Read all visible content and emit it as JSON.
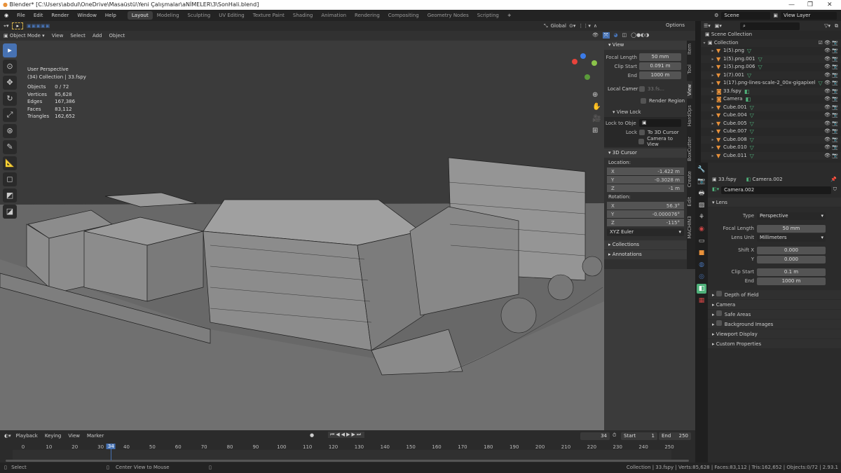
{
  "window": {
    "title": "Blender* [C:\\Users\\abdul\\OneDrive\\Masaüstü\\Yeni Çalışmalar\\aNİMELER\\3\\SonHali.blend]"
  },
  "menu": [
    "File",
    "Edit",
    "Render",
    "Window",
    "Help"
  ],
  "workspaces": [
    "Layout",
    "Modeling",
    "Sculpting",
    "UV Editing",
    "Texture Paint",
    "Shading",
    "Animation",
    "Rendering",
    "Compositing",
    "Geometry Nodes",
    "Scripting"
  ],
  "active_workspace": "Layout",
  "scene": "Scene",
  "view_layer": "View Layer",
  "viewport": {
    "orientation": "Global",
    "options": "Options",
    "mode": "Object Mode",
    "menus": [
      "View",
      "Select",
      "Add",
      "Object"
    ],
    "overlay_title": "User Perspective",
    "overlay_subtitle": "(34) Collection | 33.fspy",
    "stats": [
      [
        "Objects",
        "0 / 72"
      ],
      [
        "Vertices",
        "85,628"
      ],
      [
        "Edges",
        "167,386"
      ],
      [
        "Faces",
        "83,112"
      ],
      [
        "Triangles",
        "162,652"
      ]
    ]
  },
  "npanel": {
    "tabs": [
      "Item",
      "Tool",
      "View",
      "HardOps",
      "BoxCutter",
      "Create",
      "Edit",
      "MACHIN3"
    ],
    "active_tab": "View",
    "view": {
      "title": "View",
      "focal_length_label": "Focal Length",
      "focal_length": "50 mm",
      "clip_start_label": "Clip Start",
      "clip_start": "0.091 m",
      "end_label": "End",
      "end": "1000 m",
      "local_camera_label": "Local Camer",
      "local_camera": "33.fs...",
      "render_region": "Render Region"
    },
    "view_lock": {
      "title": "View Lock",
      "lock_to_object": "Lock to Obje",
      "lock": "Lock",
      "to_3d_cursor": "To 3D Cursor",
      "camera_to_view": "Camera to View"
    },
    "cursor": {
      "title": "3D Cursor",
      "location": "Location:",
      "loc": [
        [
          "X",
          "-1.422 m"
        ],
        [
          "Y",
          "-0.3028 m"
        ],
        [
          "Z",
          "-1 m"
        ]
      ],
      "rotation": "Rotation:",
      "rot": [
        [
          "X",
          "56.3°"
        ],
        [
          "Y",
          "-0.000076°"
        ],
        [
          "Z",
          "-115°"
        ]
      ],
      "mode": "XYZ Euler"
    },
    "collections": "Collections",
    "annotations": "Annotations"
  },
  "outliner": {
    "scene_collection": "Scene Collection",
    "collection": "Collection",
    "items": [
      {
        "name": "1(5).png",
        "type": "mesh"
      },
      {
        "name": "1(5).png.001",
        "type": "mesh"
      },
      {
        "name": "1(5).png.006",
        "type": "mesh"
      },
      {
        "name": "1(7).001",
        "type": "mesh"
      },
      {
        "name": "1(17).png-lines-scale-2_00x-gigapixel",
        "type": "mesh"
      },
      {
        "name": "33.fspy",
        "type": "camera"
      },
      {
        "name": "Camera",
        "type": "camera"
      },
      {
        "name": "Cube.001",
        "type": "mesh"
      },
      {
        "name": "Cube.004",
        "type": "mesh"
      },
      {
        "name": "Cube.005",
        "type": "mesh"
      },
      {
        "name": "Cube.007",
        "type": "mesh"
      },
      {
        "name": "Cube.008",
        "type": "mesh"
      },
      {
        "name": "Cube.010",
        "type": "mesh"
      },
      {
        "name": "Cube.011",
        "type": "mesh"
      }
    ]
  },
  "properties": {
    "object": "33.fspy",
    "data": "Camera.002",
    "datablock": "Camera.002",
    "lens": "Lens",
    "type_label": "Type",
    "type": "Perspective",
    "focal_label": "Focal Length",
    "focal": "50 mm",
    "unit_label": "Lens Unit",
    "unit": "Millimeters",
    "shiftx_label": "Shift X",
    "shiftx": "0.000",
    "shifty_label": "Y",
    "shifty": "0.000",
    "clip_start_label": "Clip Start",
    "clip_start": "0.1 m",
    "clip_end_label": "End",
    "clip_end": "1000 m",
    "subpanels": [
      "Depth of Field",
      "Camera",
      "Safe Areas",
      "Background Images",
      "Viewport Display",
      "Custom Properties"
    ]
  },
  "timeline": {
    "menus": [
      "Playback",
      "Keying",
      "View",
      "Marker"
    ],
    "current_frame": "34",
    "start_label": "Start",
    "start": "1",
    "end_label": "End",
    "end": "250",
    "ticks": [
      "0",
      "10",
      "20",
      "30",
      "40",
      "50",
      "60",
      "70",
      "80",
      "90",
      "100",
      "110",
      "120",
      "130",
      "140",
      "150",
      "160",
      "170",
      "180",
      "190",
      "200",
      "210",
      "220",
      "230",
      "240",
      "250"
    ]
  },
  "status": {
    "left": "Select",
    "middle": "Center View to Mouse",
    "right": "Collection | 33.fspy | Verts:85,628 | Faces:83,112 | Tris:162,652 | Objects:0/72 | 2.93.1"
  },
  "colors": {
    "accent": "#4772b3",
    "object_orange": "#e8913a",
    "data_green": "#4fb07a"
  }
}
